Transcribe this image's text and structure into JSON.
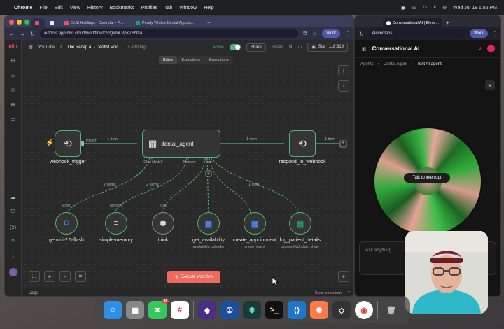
{
  "menubar": {
    "app": "Chrome",
    "items": [
      "File",
      "Edit",
      "View",
      "History",
      "Bookmarks",
      "Profiles",
      "Tab",
      "Window",
      "Help"
    ],
    "datetime": "Wed Jul 18  1:56 PM"
  },
  "left_browser": {
    "tabs": [
      {
        "label": "",
        "color": "#ea4b71"
      },
      {
        "label": "",
        "color": "#222222"
      },
      {
        "label": "OLM Holdings - Calendar - Fr...",
        "color": "#ea4b71"
      },
      {
        "label": "Pearly Whites Dental Appoin...",
        "color": "#1fa463"
      }
    ],
    "url": "ai-tools.app.n8n.cloud/workflow/r2cQWoLPpK7BNtIA",
    "profile": "Work"
  },
  "n8n": {
    "project": "YouTube",
    "workflow_name": "The Recap AI - Dentist Voic...",
    "add_tag": "+ Add tag",
    "active_label": "Active",
    "share": "Share",
    "saved": "Saved",
    "github_star": "Star",
    "github_count": "118,819",
    "tabs": [
      "Editor",
      "Executions",
      "Evaluations"
    ],
    "nodes": {
      "webhook_trigger": "webhook_trigger",
      "dental_agent": "dental_agent",
      "respond": "respond_to_webhook",
      "gemini": "gemini-2.5-flash",
      "memory": "simple-memory",
      "think": "think",
      "get_availability": "get_availability",
      "get_availability_sub": "availability: calendar",
      "create_appointment": "create_appointment",
      "create_appointment_sub": "create: event",
      "log_patient": "log_patient_details",
      "log_patient_sub": "appendOrUpdate: sheet"
    },
    "ports": {
      "chat_model": "Chat Model*",
      "memory": "Memory",
      "tool": "Tool",
      "post": "POST"
    },
    "sub_ports": {
      "model": "Model",
      "memory": "Memory",
      "tool": "Tool"
    },
    "edge_labels": {
      "e1": "1 item",
      "e2": "1 item",
      "e3": "1 item",
      "e4": "2 items",
      "e5": "2 items",
      "e6": "1 item"
    },
    "execute": "Execute workflow",
    "logs": "Logs",
    "clear_execution": "Clear execution"
  },
  "right_browser": {
    "tab": "Conversational AI | Eleve...",
    "url": "elevenlabs...",
    "profile": "Work",
    "title": "Conversational AI",
    "breadcrumb": [
      "Agents",
      "Dental Agent",
      "Test AI agent"
    ],
    "interrupt": "Talk to interrupt",
    "ask_placeholder": "Ask anything"
  },
  "dock": {
    "messages_badge": "59"
  }
}
